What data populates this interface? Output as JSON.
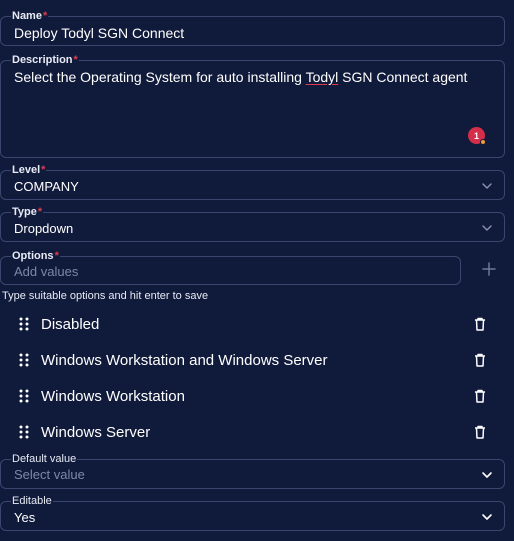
{
  "form": {
    "name": {
      "label": "Name",
      "required_mark": "*",
      "value": "Deploy Todyl SGN Connect"
    },
    "description": {
      "label": "Description",
      "required_mark": "*",
      "value_before": "Select the Operating System for auto installing ",
      "value_misspelled": "Todyl",
      "value_after": " SGN Connect agent",
      "issue_count": "1"
    },
    "level": {
      "label": "Level",
      "required_mark": "*",
      "value": "COMPANY"
    },
    "type": {
      "label": "Type",
      "required_mark": "*",
      "value": "Dropdown"
    },
    "options": {
      "label": "Options",
      "required_mark": "*",
      "placeholder": "Add values",
      "hint": "Type suitable options and hit enter to save",
      "items": [
        {
          "label": "Disabled"
        },
        {
          "label": "Windows Workstation and Windows Server"
        },
        {
          "label": "Windows Workstation"
        },
        {
          "label": "Windows Server"
        }
      ]
    },
    "default_value": {
      "label": "Default value",
      "placeholder": "Select value"
    },
    "editable": {
      "label": "Editable",
      "value": "Yes"
    }
  },
  "colors": {
    "background": "#101a3a",
    "border": "#3a4670",
    "required": "#e03a4e",
    "badge": "#d42e4b"
  },
  "icons": {
    "chevron": "chevron-down-icon",
    "drag": "drag-handle-icon",
    "delete": "trash-icon",
    "add": "plus-icon"
  }
}
